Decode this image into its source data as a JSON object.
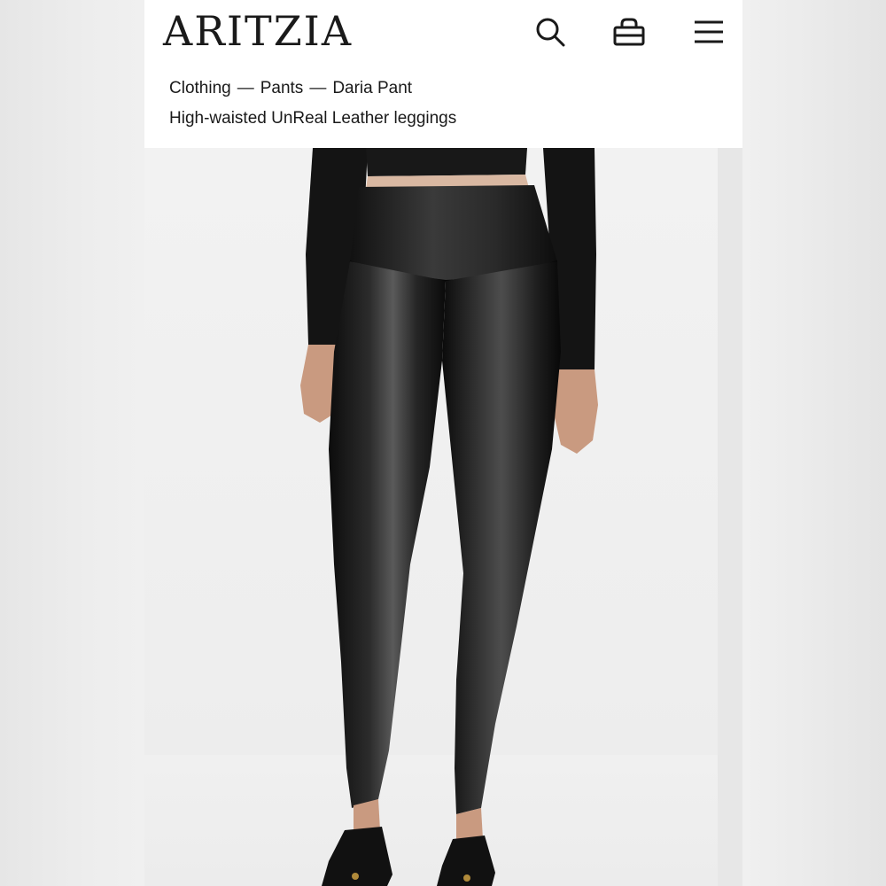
{
  "header": {
    "logo": "ARITZIA",
    "search_label": "search",
    "bag_label": "bag",
    "menu_label": "menu"
  },
  "breadcrumb": {
    "items": [
      "Clothing",
      "Pants",
      "Daria Pant"
    ],
    "separator": "—"
  },
  "product": {
    "title": "High-waisted UnReal Leather leggings"
  },
  "icons": {
    "search": "search-icon",
    "bag": "shopping-bag-icon",
    "menu": "hamburger-menu-icon"
  },
  "colors": {
    "header_bg": "#ffffff",
    "text": "#1a1a1a",
    "background": "#ececec"
  }
}
